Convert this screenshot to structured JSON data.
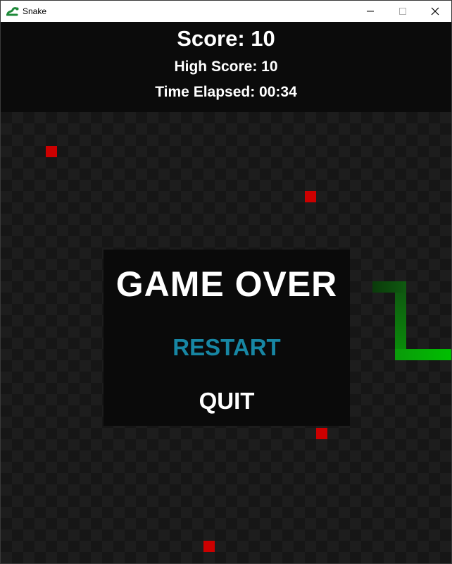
{
  "window": {
    "title": "Snake",
    "icon": "snake-icon",
    "controls": [
      "minimize-icon",
      "maximize-icon",
      "close-icon"
    ]
  },
  "header": {
    "score": "Score: 10",
    "high_score": "High Score: 10",
    "time_elapsed": "Time Elapsed: 00:34"
  },
  "game_over": {
    "title": "GAME OVER",
    "restart_label": "RESTART",
    "quit_label": "QUIT"
  },
  "colors": {
    "food": "#cc0000",
    "snake_head": "#00c000",
    "snake_tail": "#0a3a0a",
    "restart_highlight": "#1786a3",
    "board_light": "#1d1d1d",
    "board_dark": "#161616"
  }
}
